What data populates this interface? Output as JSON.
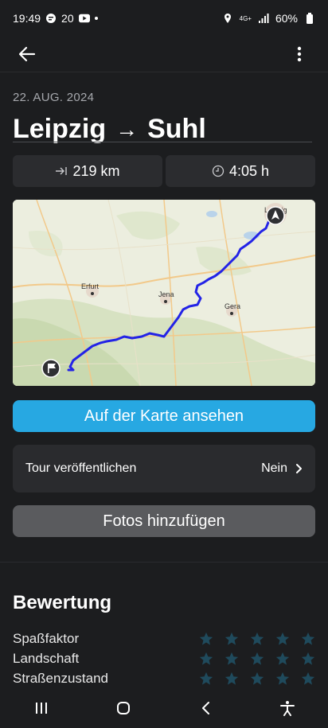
{
  "status_bar": {
    "time": "19:49",
    "notif_count": "20",
    "signal_label": "4G+",
    "battery": "60%"
  },
  "appbar": {
    "back_icon": "arrow-left-icon",
    "more_icon": "more-vert-icon"
  },
  "tour": {
    "date": "22. AUG. 2024",
    "from": "Leipzig",
    "arrow": "→",
    "to": "Suhl",
    "distance": "219 km",
    "duration": "4:05 h"
  },
  "map": {
    "labels": {
      "erfurt": "Erfurt",
      "jena": "Jena",
      "gera": "Gera",
      "leipzig": "Leipzig"
    },
    "route_color": "#2323e6"
  },
  "actions": {
    "view_on_map": "Auf der Karte ansehen",
    "publish_label": "Tour veröffentlichen",
    "publish_value": "Nein",
    "add_photos": "Fotos hinzufügen"
  },
  "rating": {
    "title": "Bewertung",
    "rows": [
      {
        "label": "Spaßfaktor",
        "stars": 0,
        "max": 5
      },
      {
        "label": "Landschaft",
        "stars": 0,
        "max": 5
      },
      {
        "label": "Straßenzustand",
        "stars": 0,
        "max": 5
      }
    ]
  },
  "navbar": {
    "recents_icon": "recents-icon",
    "home_icon": "home-icon",
    "back_icon": "back-icon",
    "accessibility_icon": "accessibility-icon"
  },
  "colors": {
    "background": "#1c1d1f",
    "primary": "#27a8e2",
    "surface": "#2b2c2f",
    "star_empty": "#1f4a5c"
  }
}
